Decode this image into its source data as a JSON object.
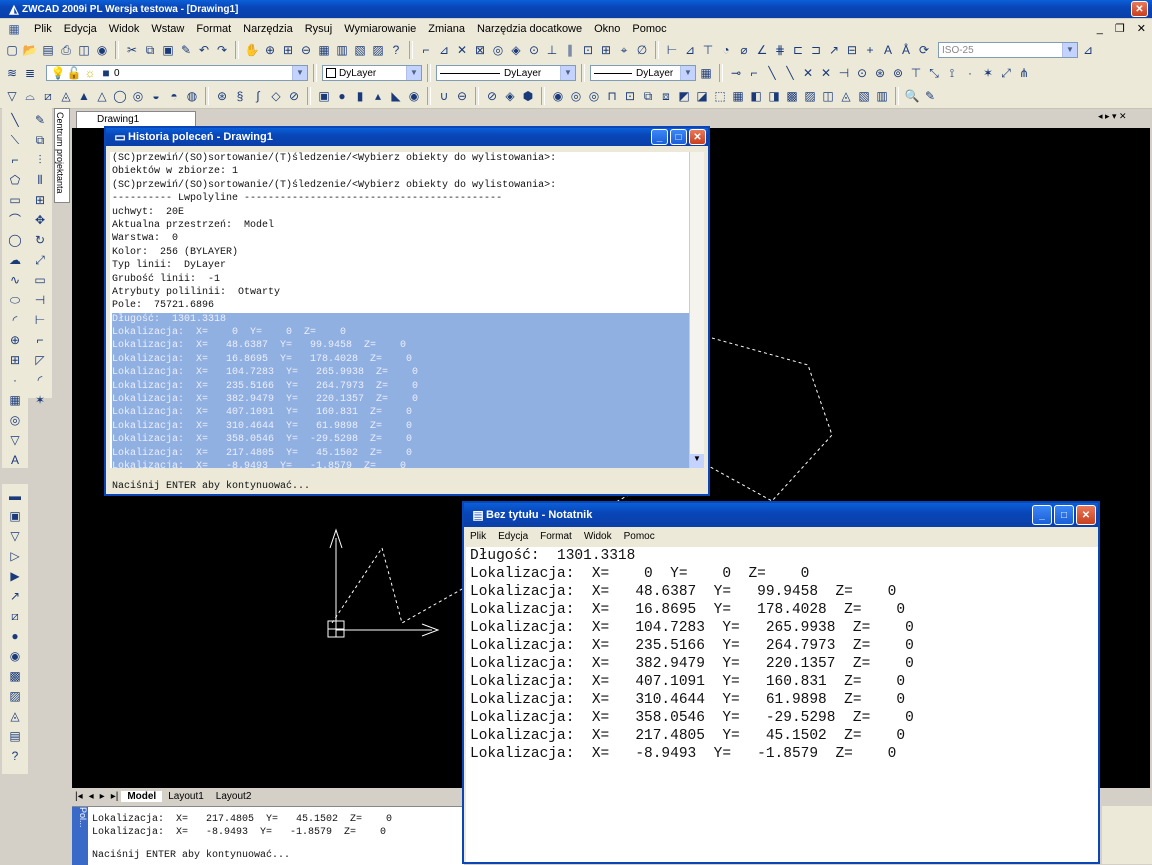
{
  "main_window": {
    "title": "ZWCAD 2009i PL Wersja testowa - [Drawing1]",
    "min": "_",
    "restore": "❐",
    "close": "✕"
  },
  "menu": [
    "Plik",
    "Edycja",
    "Widok",
    "Wstaw",
    "Format",
    "Narzędzia",
    "Rysuj",
    "Wymiarowanie",
    "Zmiana",
    "Narzędzia docatkowe",
    "Okno",
    "Pomoc"
  ],
  "toolbar2": {
    "layer_value": "0",
    "color_value": "DyLayer",
    "linetype_value": "DyLayer",
    "lineweight_value": "DyLayer",
    "dimstyle_value": "ISO-25"
  },
  "drawing_tab": "Drawing1",
  "center_panel_label": "Centrum projektanta",
  "layout_tabs": [
    "Model",
    "Layout1",
    "Layout2"
  ],
  "history": {
    "title": "Historia poleceń - Drawing1",
    "lines": [
      "(SC)przewiń/(SO)sortowanie/(T)śledzenie/<Wybierz obiekty do wylistowania>:",
      "Obiektów w zbiorze: 1",
      "(SC)przewiń/(SO)sortowanie/(T)śledzenie/<Wybierz obiekty do wylistowania>:",
      "---------- Lwpolyline -------------------------------------------",
      "uchwyt:  20E",
      "Aktualna przestrzeń:  Model",
      "Warstwa:  0",
      "Kolor:  256 (BYLAYER)",
      "Typ linii:  DyLayer",
      "Grubość linii:  -1",
      "Atrybuty polilinii:  Otwarty",
      "Pole:  75721.6896",
      "Długość:  1301.3318",
      "Lokalizacja:  X=    0  Y=    0  Z=    0",
      "Lokalizacja:  X=   48.6387  Y=   99.9458  Z=    0",
      "Lokalizacja:  X=   16.8695  Y=   178.4028  Z=    0",
      "Lokalizacja:  X=   104.7283  Y=   265.9938  Z=    0",
      "Lokalizacja:  X=   235.5166  Y=   264.7973  Z=    0",
      "Lokalizacja:  X=   382.9479  Y=   220.1357  Z=    0",
      "Lokalizacja:  X=   407.1091  Y=   160.831  Z=    0",
      "Lokalizacja:  X=   310.4644  Y=   61.9898  Z=    0",
      "Lokalizacja:  X=   358.0546  Y=  -29.5298  Z=    0",
      "Lokalizacja:  X=   217.4805  Y=   45.1502  Z=    0",
      "Lokalizacja:  X=   -8.9493  Y=   -1.8579  Z=    0"
    ],
    "prompt": "Naciśnij ENTER aby kontynuować..."
  },
  "notepad": {
    "title": "Bez tytułu - Notatnik",
    "menu": [
      "Plik",
      "Edycja",
      "Format",
      "Widok",
      "Pomoc"
    ],
    "lines": [
      "Długość:  1301.3318",
      "Lokalizacja:  X=    0  Y=    0  Z=    0",
      "Lokalizacja:  X=   48.6387  Y=   99.9458  Z=    0",
      "Lokalizacja:  X=   16.8695  Y=   178.4028  Z=    0",
      "Lokalizacja:  X=   104.7283  Y=   265.9938  Z=    0",
      "Lokalizacja:  X=   235.5166  Y=   264.7973  Z=    0",
      "Lokalizacja:  X=   382.9479  Y=   220.1357  Z=    0",
      "Lokalizacja:  X=   407.1091  Y=   160.831  Z=    0",
      "Lokalizacja:  X=   310.4644  Y=   61.9898  Z=    0",
      "Lokalizacja:  X=   358.0546  Y=   -29.5298  Z=    0",
      "Lokalizacja:  X=   217.4805  Y=   45.1502  Z=    0",
      "Lokalizacja:  X=   -8.9493  Y=   -1.8579  Z=    0"
    ]
  },
  "command_area": {
    "label": "Pol...",
    "lines": [
      "Lokalizacja:  X=   217.4805  Y=   45.1502  Z=    0",
      "Lokalizacja:  X=   -8.9493  Y=   -1.8579  Z=    0"
    ],
    "prompt": "Naciśnij ENTER aby kontynuować..."
  },
  "colors": {
    "xp_blue": "#0a46b8",
    "canvas": "#000000",
    "selection": "#8fb0e0",
    "chrome": "#ece9d8"
  }
}
